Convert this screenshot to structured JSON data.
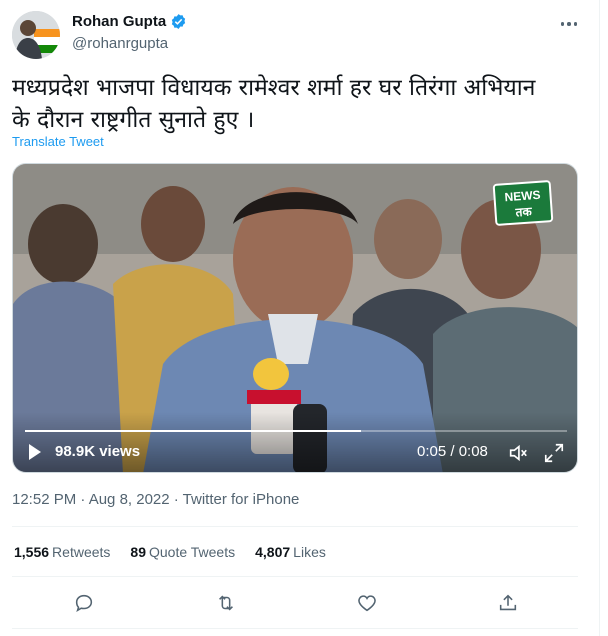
{
  "author": {
    "name": "Rohan Gupta",
    "handle": "@rohanrgupta",
    "verified_color": "#1d9bf0"
  },
  "tweet": {
    "line1": "मध्यप्रदेश भाजपा विधायक रामेश्वर शर्मा हर घर तिरंगा अभियान",
    "line2": "के दौरान राष्ट्रगीत सुनाते हुए ।",
    "translate_label": "Translate Tweet"
  },
  "video": {
    "views": "98.9K views",
    "time": "0:05 / 0:08",
    "progress_fraction": 0.62,
    "logo_line1": "NEWS",
    "logo_line2": "तक"
  },
  "meta": {
    "timestamp": "12:52 PM · Aug 8, 2022 · Twitter for iPhone"
  },
  "stats": {
    "retweets_count": "1,556",
    "retweets_label": "Retweets",
    "quotes_count": "89",
    "quotes_label": "Quote Tweets",
    "likes_count": "4,807",
    "likes_label": "Likes"
  },
  "icons": {
    "reply": "reply-icon",
    "retweet": "retweet-icon",
    "like": "heart-icon",
    "share": "share-icon"
  },
  "colors": {
    "accent": "#1d9bf0",
    "muted": "#536471",
    "text": "#0f1419"
  }
}
